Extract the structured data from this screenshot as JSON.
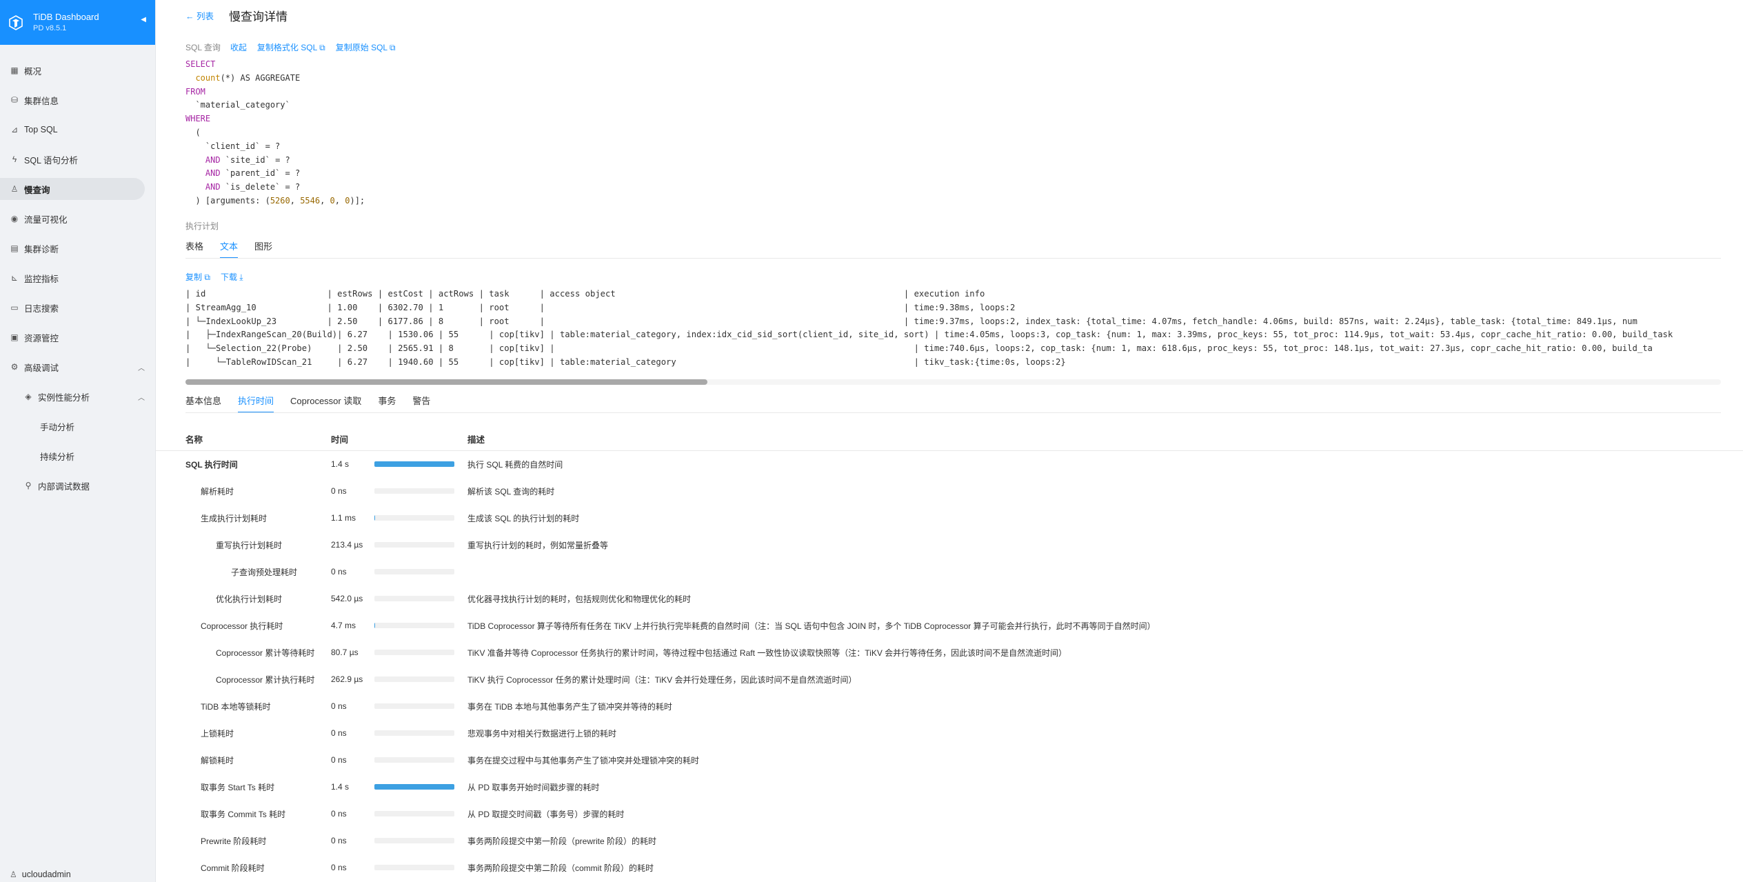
{
  "brand": {
    "title": "TiDB Dashboard",
    "version": "PD v8.5.1"
  },
  "sidebar": {
    "items": [
      {
        "label": "概况",
        "icon": "overview-icon"
      },
      {
        "label": "集群信息",
        "icon": "cluster-icon"
      },
      {
        "label": "Top SQL",
        "icon": "chart-icon"
      },
      {
        "label": "SQL 语句分析",
        "icon": "thunder-icon"
      },
      {
        "label": "慢查询",
        "icon": "slow-query-icon"
      },
      {
        "label": "流量可视化",
        "icon": "eye-icon"
      },
      {
        "label": "集群诊断",
        "icon": "diagnose-icon"
      },
      {
        "label": "监控指标",
        "icon": "monitor-icon"
      },
      {
        "label": "日志搜索",
        "icon": "log-icon"
      },
      {
        "label": "资源管控",
        "icon": "resource-icon"
      },
      {
        "label": "高级调试",
        "icon": "debug-icon"
      },
      {
        "label": "实例性能分析",
        "icon": "profile-icon"
      },
      {
        "label": "手动分析"
      },
      {
        "label": "持续分析"
      },
      {
        "label": "内部调试数据",
        "icon": "link-icon"
      }
    ],
    "user": "ucloudadmin"
  },
  "header": {
    "back": "列表",
    "title": "慢查询详情"
  },
  "sql": {
    "label": "SQL 查询",
    "collapse": "收起",
    "copy_formatted": "复制格式化 SQL",
    "copy_original": "复制原始 SQL",
    "lines": {
      "l1": "SELECT",
      "l2a": "count",
      "l2b": "(*) AS AGGREGATE",
      "l3": "FROM",
      "l4": "  `material_category`",
      "l5": "WHERE",
      "l6": "  (",
      "l7": "    `client_id` = ?",
      "l8a": "AND",
      "l8b": " `site_id` = ?",
      "l9a": "AND",
      "l9b": " `parent_id` = ?",
      "l10a": "AND",
      "l10b": " `is_delete` = ?",
      "l11a": "  ) [arguments: (",
      "l11b": "5260",
      "l11c": ", ",
      "l11d": "5546",
      "l11e": ", ",
      "l11f": "0",
      "l11g": ", ",
      "l11h": "0",
      "l11i": ")];"
    }
  },
  "plan": {
    "label": "执行计划",
    "tabs": [
      "表格",
      "文本",
      "图形"
    ],
    "copy": "复制",
    "download": "下载",
    "text": "| id                        | estRows | estCost | actRows | task      | access object                                                         | execution info\n| StreamAgg_10              | 1.00    | 6302.70 | 1       | root      |                                                                       | time:9.38ms, loops:2\n| └─IndexLookUp_23          | 2.50    | 6177.86 | 8       | root      |                                                                       | time:9.37ms, loops:2, index_task: {total_time: 4.07ms, fetch_handle: 4.06ms, build: 857ns, wait: 2.24µs}, table_task: {total_time: 849.1µs, num\n|   ├─IndexRangeScan_20(Build)| 6.27    | 1530.06 | 55      | cop[tikv] | table:material_category, index:idx_cid_sid_sort(client_id, site_id, sort) | time:4.05ms, loops:3, cop_task: {num: 1, max: 3.39ms, proc_keys: 55, tot_proc: 114.9µs, tot_wait: 53.4µs, copr_cache_hit_ratio: 0.00, build_task\n|   └─Selection_22(Probe)     | 2.50    | 2565.91 | 8       | cop[tikv] |                                                                       | time:740.6µs, loops:2, cop_task: {num: 1, max: 618.6µs, proc_keys: 55, tot_proc: 148.1µs, tot_wait: 27.3µs, copr_cache_hit_ratio: 0.00, build_ta\n|     └─TableRowIDScan_21     | 6.27    | 1940.60 | 55      | cop[tikv] | table:material_category                                               | tikv_task:{time:0s, loops:2}",
    "scroll_fraction": 0.34
  },
  "detail_tabs": [
    "基本信息",
    "执行时间",
    "Coprocessor 读取",
    "事务",
    "警告"
  ],
  "timing": {
    "headers": {
      "name": "名称",
      "time": "时间",
      "desc": "描述"
    },
    "rows": [
      {
        "name": "SQL 执行时间",
        "time": "1.4 s",
        "ratio": 1.0,
        "desc": "执行 SQL 耗费的自然时间"
      },
      {
        "name": "解析耗时",
        "time": "0 ns",
        "ratio": 0,
        "desc": "解析该 SQL 查询的耗时"
      },
      {
        "name": "生成执行计划耗时",
        "time": "1.1 ms",
        "ratio": 0.01,
        "desc": "生成该 SQL 的执行计划的耗时"
      },
      {
        "name": "重写执行计划耗时",
        "time": "213.4 µs",
        "ratio": 0,
        "desc": "重写执行计划的耗时，例如常量折叠等"
      },
      {
        "name": "子查询预处理耗时",
        "time": "0 ns",
        "ratio": 0,
        "desc": ""
      },
      {
        "name": "优化执行计划耗时",
        "time": "542.0 µs",
        "ratio": 0,
        "desc": "优化器寻找执行计划的耗时，包括规则优化和物理优化的耗时"
      },
      {
        "name": "Coprocessor 执行耗时",
        "time": "4.7 ms",
        "ratio": 0.01,
        "desc": "TiDB Coprocessor 算子等待所有任务在 TiKV 上并行执行完毕耗费的自然时间（注：当 SQL 语句中包含 JOIN 时，多个 TiDB Coprocessor 算子可能会并行执行，此时不再等同于自然时间）"
      },
      {
        "name": "Coprocessor 累计等待耗时",
        "time": "80.7 µs",
        "ratio": 0,
        "desc": "TiKV 准备并等待 Coprocessor 任务执行的累计时间，等待过程中包括通过 Raft 一致性协议读取快照等（注：TiKV 会并行等待任务，因此该时间不是自然流逝时间）"
      },
      {
        "name": "Coprocessor 累计执行耗时",
        "time": "262.9 µs",
        "ratio": 0,
        "desc": "TiKV 执行 Coprocessor 任务的累计处理时间（注：TiKV 会并行处理任务，因此该时间不是自然流逝时间）"
      },
      {
        "name": "TiDB 本地等锁耗时",
        "time": "0 ns",
        "ratio": 0,
        "desc": "事务在 TiDB 本地与其他事务产生了锁冲突并等待的耗时"
      },
      {
        "name": "上锁耗时",
        "time": "0 ns",
        "ratio": 0,
        "desc": "悲观事务中对相关行数据进行上锁的耗时"
      },
      {
        "name": "解锁耗时",
        "time": "0 ns",
        "ratio": 0,
        "desc": "事务在提交过程中与其他事务产生了锁冲突并处理锁冲突的耗时"
      },
      {
        "name": "取事务 Start Ts 耗时",
        "time": "1.4 s",
        "ratio": 1.0,
        "desc": "从 PD 取事务开始时间戳步骤的耗时"
      },
      {
        "name": "取事务 Commit Ts 耗时",
        "time": "0 ns",
        "ratio": 0,
        "desc": "从 PD 取提交时间戳（事务号）步骤的耗时"
      },
      {
        "name": "Prewrite 阶段耗时",
        "time": "0 ns",
        "ratio": 0,
        "desc": "事务两阶段提交中第一阶段（prewrite 阶段）的耗时"
      },
      {
        "name": "Commit 阶段耗时",
        "time": "0 ns",
        "ratio": 0,
        "desc": "事务两阶段提交中第二阶段（commit 阶段）的耗时"
      }
    ]
  },
  "colors": {
    "accent": "#1890ff",
    "bar": "#3da0e2"
  }
}
